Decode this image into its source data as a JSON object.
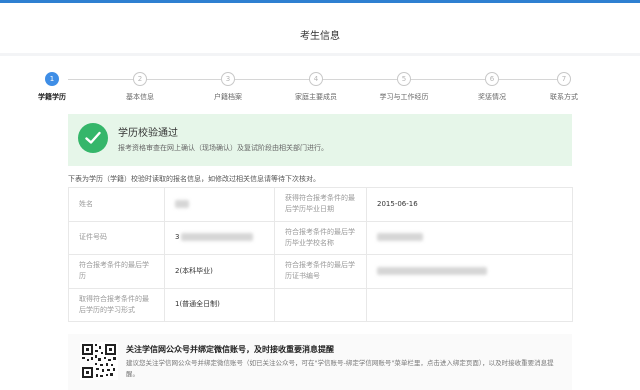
{
  "header": {
    "title": "考生信息"
  },
  "steps": [
    {
      "num": "1",
      "label": "学籍学历",
      "active": true
    },
    {
      "num": "2",
      "label": "基本信息",
      "active": false
    },
    {
      "num": "3",
      "label": "户籍档案",
      "active": false
    },
    {
      "num": "4",
      "label": "家庭主要成员",
      "active": false
    },
    {
      "num": "5",
      "label": "学习与工作经历",
      "active": false
    },
    {
      "num": "6",
      "label": "奖惩情况",
      "active": false
    },
    {
      "num": "7",
      "label": "联系方式",
      "active": false
    }
  ],
  "banner": {
    "title": "学历校验通过",
    "desc": "报考资格审查在网上确认（现场确认）及复试阶段由相关部门进行。",
    "color": "#35b66a"
  },
  "tip": "下表为学历（学籍）校验时读取的报名信息，如修改过相关信息请等待下次核对。",
  "table": {
    "r1": {
      "k1": "姓名",
      "v1": "",
      "k2": "获得符合报考条件的最后学历毕业日期",
      "v2": "2015-06-16"
    },
    "r2": {
      "k1": "证件号码",
      "v1": "3",
      "k2": "符合报考条件的最后学历毕业学校名称",
      "v2": ""
    },
    "r3": {
      "k1": "符合报考条件的最后学历",
      "v1": "2(本科毕业)",
      "k2": "符合报考条件的最后学历证书编号",
      "v2": ""
    },
    "r4": {
      "k1": "取得符合报考条件的最后学历的学习形式",
      "v1": "1(普通全日制)"
    }
  },
  "notice": {
    "title": "关注学信网公众号并绑定微信账号，及时接收重要消息提醒",
    "desc": "建议您关注学信网公众号并绑定微信账号（如已关注公众号，可在\"学信账号-绑定学信网账号\"菜单栏里，点击进入绑定页面），以及时接收重要消息提醒。",
    "icon": "qr-code-icon"
  },
  "colors": {
    "accent": "#3f8ee6",
    "success": "#35b66a",
    "banner_bg": "#e6f6e9"
  }
}
